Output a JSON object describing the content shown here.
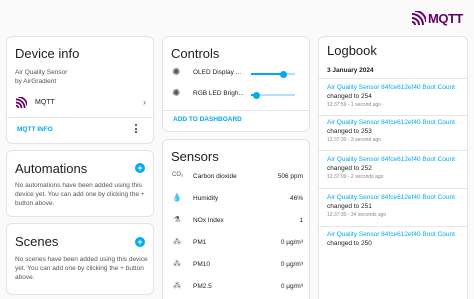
{
  "brand": {
    "logo_text": "MQTT"
  },
  "device_info": {
    "title": "Device info",
    "model": "Air Quality Sensor",
    "manufacturer": "by AirGradient",
    "integration_label": "MQTT",
    "mqtt_info_label": "MQTT INFO"
  },
  "automations": {
    "title": "Automations",
    "empty_text_1": "No automations have been added using this",
    "empty_text_2": "device yet. You can add one by clicking the +",
    "empty_text_3": "button above."
  },
  "scenes": {
    "title": "Scenes",
    "empty_text_1": "No scenes have been added using this device",
    "empty_text_2": "yet. You can add one by clicking the + button",
    "empty_text_3": "above."
  },
  "controls": {
    "title": "Controls",
    "items": [
      {
        "label": "OLED Display ...",
        "level_pct": 75
      },
      {
        "label": "RGB LED Brigh...",
        "level_pct": 10
      }
    ],
    "add_to_dashboard": "ADD TO DASHBOARD"
  },
  "sensors": {
    "title": "Sensors",
    "items": [
      {
        "icon": "co2-icon",
        "label": "Carbon dioxide",
        "value": "506 ppm"
      },
      {
        "icon": "humidity-icon",
        "label": "Humidity",
        "value": "46%"
      },
      {
        "icon": "nox-icon",
        "label": "NOx Index",
        "value": "1"
      },
      {
        "icon": "pm-icon",
        "label": "PM1",
        "value": "0 µg/m³"
      },
      {
        "icon": "pm-icon",
        "label": "PM10",
        "value": "0 µg/m³"
      },
      {
        "icon": "pm-icon",
        "label": "PM2.5",
        "value": "0 µg/m³"
      }
    ]
  },
  "logbook": {
    "title": "Logbook",
    "date": "3 January 2024",
    "entries": [
      {
        "title": "Air Quality Sensor 84fce612ef40 Boot Count",
        "text": "changed to 254",
        "time": "12:37:59 - 1 second ago"
      },
      {
        "title": "Air Quality Sensor 84fce612ef40 Boot Count",
        "text": "changed to 253",
        "time": "12:37:30 - 3 second ago"
      },
      {
        "title": "Air Quality Sensor 84fce612ef40 Boot Count",
        "text": "changed to 252",
        "time": "12:37:09 - 2 seconds ago"
      },
      {
        "title": "Air Quality Sensor 84fce612ef40 Boot Count",
        "text": "changed to 251",
        "time": "12:37:30 - 34 seconds ago"
      },
      {
        "title": "Air Quality Sensor 84fce612ef40 Boot Count",
        "text": "changed to 250",
        "time": ""
      }
    ]
  },
  "colors": {
    "accent": "#03a9f4",
    "mqtt_purple": "#660066"
  }
}
